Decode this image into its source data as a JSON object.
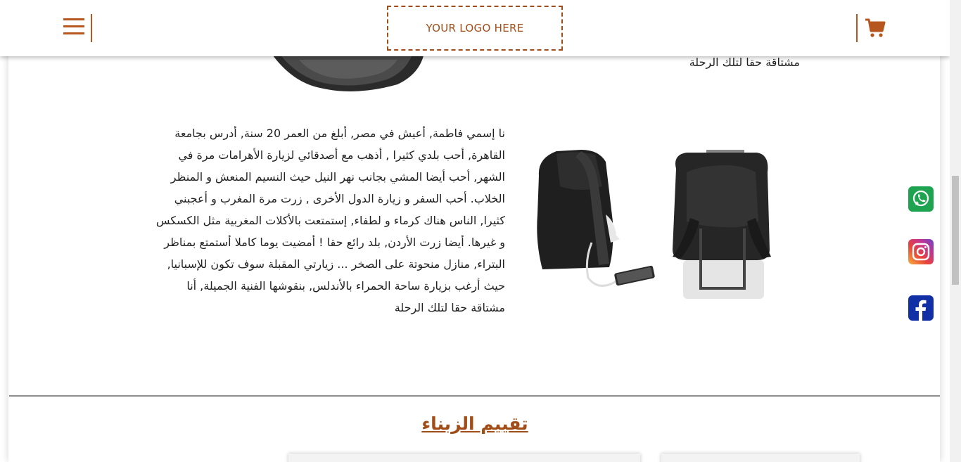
{
  "header": {
    "logo_text": "YOUR LOGO HERE",
    "menu_icon": "hamburger-menu-icon",
    "cart_icon": "shopping-cart-icon"
  },
  "previous_section": {
    "tail_text": "مشتاقة حقا لتلك الرحلة"
  },
  "story": {
    "text": "نا إسمي فاطمة, أعيش في مصر, أبلغ من العمر 20 سنة, أدرس بجامعة القاهرة, أحب بلدي كثيرا , أذهب مع أصدقائي لزيارة الأهرامات مرة في الشهر, أحب أيضا المشي بجانب نهر النيل حيث النسيم المنعش و المنظر الخلاب. أحب السفر و زيارة الدول الأخرى , زرت مرة المغرب و أعجبني كثيرا, الناس هناك كرماء و لطفاء, إستمتعت بالأكلات المغربية مثل الكسكس و غيرها. أيضا زرت الأردن, بلد رائع حقا ! أمضيت يوما كاملا أستمتع بمناظر البتراء, منازل منحوتة على الصخر ... زيارتي المقبلة سوف تكون للإسبانيا, حيث أرغب بزيارة ساحة الحمراء بالأندلس, بنقوشها الفنية الجميلة, أنا مشتاقة حقا لتلك الرحلة"
  },
  "reviews": {
    "title": "تقييم الزبناء"
  },
  "social": {
    "whatsapp_icon": "whatsapp-icon",
    "instagram_icon": "instagram-icon",
    "facebook_icon": "facebook-icon"
  },
  "colors": {
    "accent": "#a14d17",
    "whatsapp": "#1ea350",
    "facebook": "#1230a5"
  }
}
